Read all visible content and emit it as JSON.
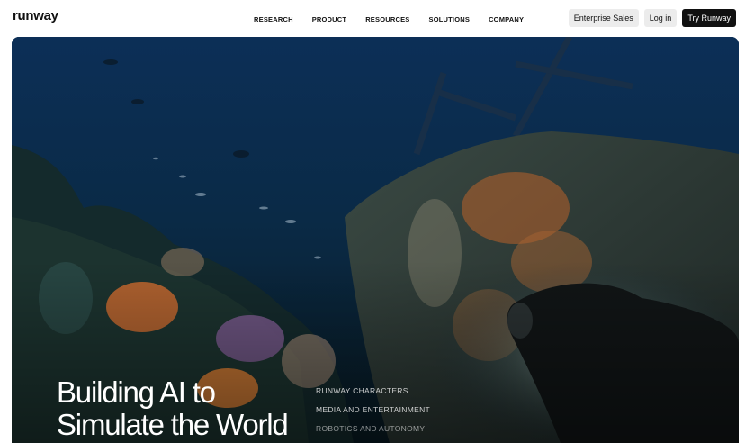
{
  "header": {
    "logo": "runway",
    "nav": [
      {
        "label": "RESEARCH"
      },
      {
        "label": "PRODUCT"
      },
      {
        "label": "RESOURCES"
      },
      {
        "label": "SOLUTIONS"
      },
      {
        "label": "COMPANY"
      }
    ],
    "enterprise_label": "Enterprise Sales",
    "login_label": "Log in",
    "try_label": "Try Runway"
  },
  "hero": {
    "title_line1": "Building AI to",
    "title_line2": "Simulate the World",
    "links": [
      {
        "label": "RUNWAY CHARACTERS"
      },
      {
        "label": "MEDIA AND ENTERTAINMENT"
      },
      {
        "label": "ROBOTICS AND AUTONOMY"
      }
    ]
  },
  "colors": {
    "primary_button": "#111111",
    "secondary_button": "#ececec",
    "ocean_deep": "#0b2946"
  }
}
